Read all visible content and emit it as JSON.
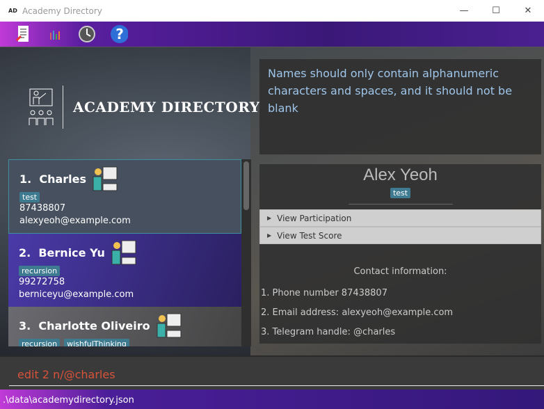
{
  "window": {
    "icon_text": "AD",
    "title": "Academy Directory",
    "minimize": "—",
    "maximize": "☐",
    "close": "✕"
  },
  "toolbar": [
    {
      "icon": "notes-icon"
    },
    {
      "icon": "chart-icon"
    },
    {
      "icon": "clock-icon"
    },
    {
      "icon": "help-icon"
    }
  ],
  "logo": {
    "text": "ACADEMY DIRECTORY"
  },
  "result": {
    "text": "Names should only contain alphanumeric characters and spaces, and it should not be blank"
  },
  "students": [
    {
      "index": "1.",
      "name": "Charles",
      "tags": [
        "test"
      ],
      "phone": "87438807",
      "email": "alexyeoh@example.com"
    },
    {
      "index": "2.",
      "name": "Bernice Yu",
      "tags": [
        "recursion"
      ],
      "phone": "99272758",
      "email": "berniceyu@example.com"
    },
    {
      "index": "3.",
      "name": "Charlotte Oliveiro",
      "tags": [
        "recursion",
        "wishfulThinking"
      ]
    }
  ],
  "detail": {
    "name": "Alex Yeoh",
    "tag": "test",
    "accordions": [
      "View Participation",
      "View Test Score"
    ],
    "contact_header": "Contact information:",
    "contact": [
      "1. Phone number 87438807",
      "2. Email address: alexyeoh@example.com",
      "3. Telegram handle: @charles"
    ]
  },
  "command": {
    "value": "edit 2 n/@charles"
  },
  "status": {
    "path": ".\\data\\academydirectory.json"
  }
}
